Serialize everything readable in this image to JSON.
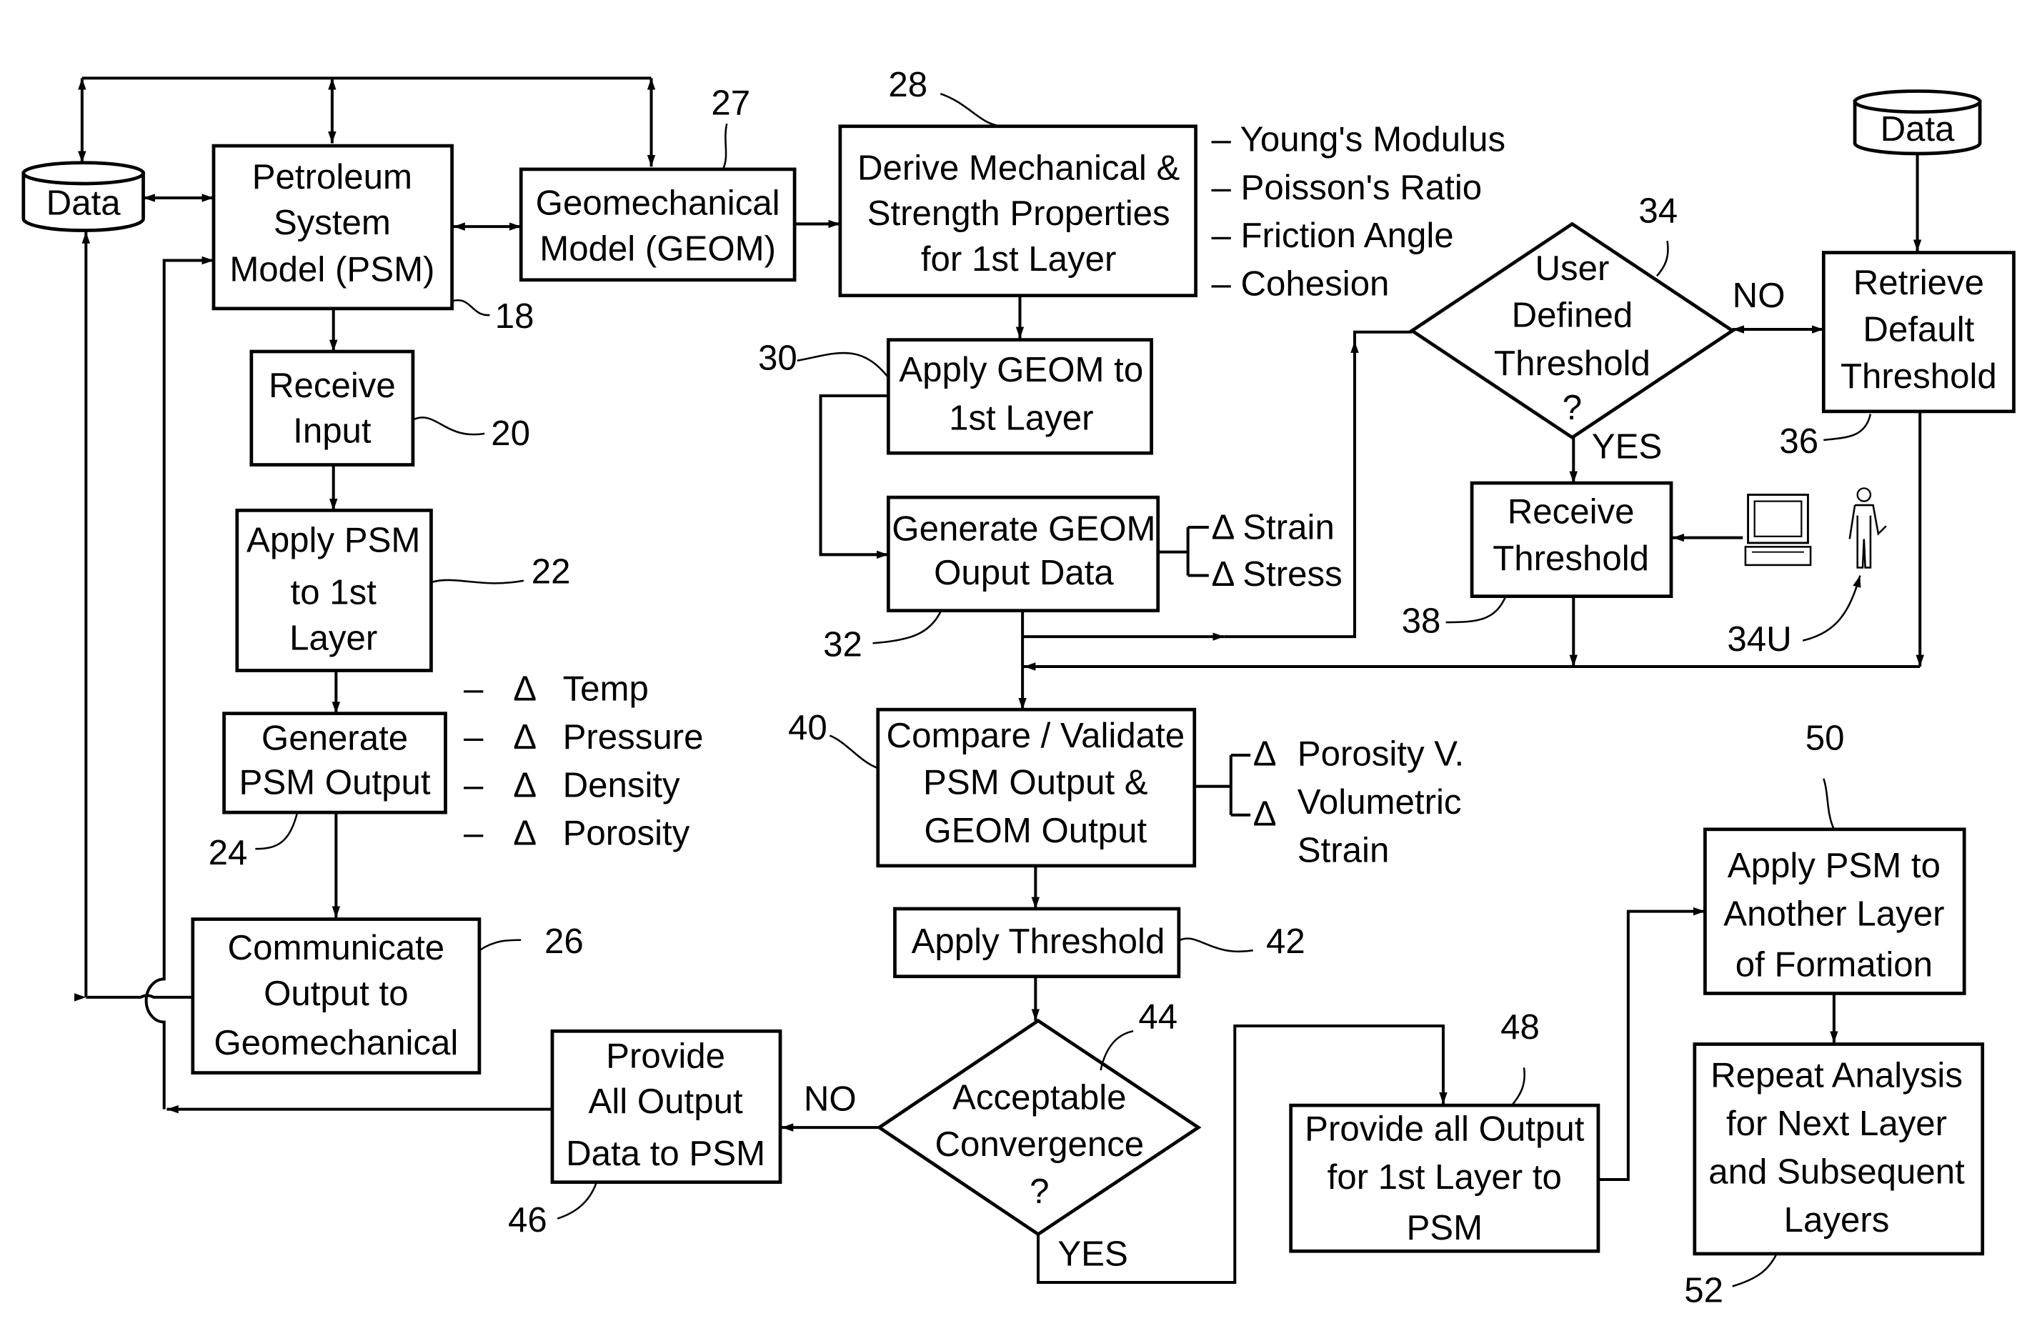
{
  "figure": {
    "data_stores": {
      "left": "Data",
      "right": "Data"
    },
    "boxes": {
      "psm": [
        "Petroleum",
        "System",
        "Model (PSM)"
      ],
      "geom": [
        "Geomechanical",
        "Model (GEOM)"
      ],
      "derive": [
        "Derive Mechanical &",
        "Strength Properties",
        "for 1st Layer"
      ],
      "receive_input": [
        "Receive",
        "Input"
      ],
      "apply_psm": [
        "Apply PSM",
        "to 1st",
        "Layer"
      ],
      "generate_psm": [
        "Generate",
        "PSM Output"
      ],
      "communicate": [
        "Communicate",
        "Output to",
        "Geomechanical"
      ],
      "apply_geom": [
        "Apply GEOM to",
        "1st Layer"
      ],
      "generate_geom": [
        "Generate GEOM",
        "Ouput Data"
      ],
      "compare": [
        "Compare / Validate",
        "PSM Output &",
        "GEOM Output"
      ],
      "apply_threshold": [
        "Apply Threshold"
      ],
      "provide_all_psm": [
        "Provide",
        "All Output",
        "Data to PSM"
      ],
      "provide_first_layer": [
        "Provide all Output",
        "for 1st Layer to",
        "PSM"
      ],
      "receive_threshold": [
        "Receive",
        "Threshold"
      ],
      "retrieve_default": [
        "Retrieve",
        "Default",
        "Threshold"
      ],
      "apply_psm_another": [
        "Apply PSM to",
        "Another Layer",
        "of Formation"
      ],
      "repeat_analysis": [
        "Repeat Analysis",
        "for Next Layer",
        "and Subsequent",
        "Layers"
      ]
    },
    "decisions": {
      "user_defined": [
        "User",
        "Defined",
        "Threshold",
        "?"
      ],
      "convergence": [
        "Acceptable",
        "Convergence",
        "?"
      ]
    },
    "branch_labels": {
      "user_no": "NO",
      "user_yes": "YES",
      "conv_no": "NO",
      "conv_yes": "YES"
    },
    "side_lists": {
      "mechanical_properties": [
        "– Young's Modulus",
        "– Poisson's Ratio",
        "– Friction Angle",
        "– Cohesion"
      ],
      "psm_outputs": [
        {
          "dash": "–",
          "delta": "Δ",
          "text": "Temp"
        },
        {
          "dash": "–",
          "delta": "Δ",
          "text": "Pressure"
        },
        {
          "dash": "–",
          "delta": "Δ",
          "text": "Density"
        },
        {
          "dash": "–",
          "delta": "Δ",
          "text": "Porosity"
        }
      ],
      "geom_outputs": [
        "Δ Strain",
        "Δ Stress"
      ],
      "compare_outputs": [
        "Δ",
        "Porosity V.",
        "Δ",
        "Volumetric",
        "Strain"
      ]
    },
    "reference_numerals": {
      "psm": "18",
      "receive_input": "20",
      "apply_psm": "22",
      "generate_psm": "24",
      "communicate": "26",
      "geom": "27",
      "derive": "28",
      "apply_geom": "30",
      "generate_geom": "32",
      "user_defined": "34",
      "user": "34U",
      "retrieve_default": "36",
      "receive_threshold": "38",
      "compare": "40",
      "apply_threshold": "42",
      "convergence": "44",
      "provide_all_psm": "46",
      "provide_first_layer": "48",
      "apply_psm_another": "50",
      "repeat_analysis": "52"
    },
    "icons": {
      "computer": "computer-terminal-icon",
      "user": "person-icon"
    }
  }
}
